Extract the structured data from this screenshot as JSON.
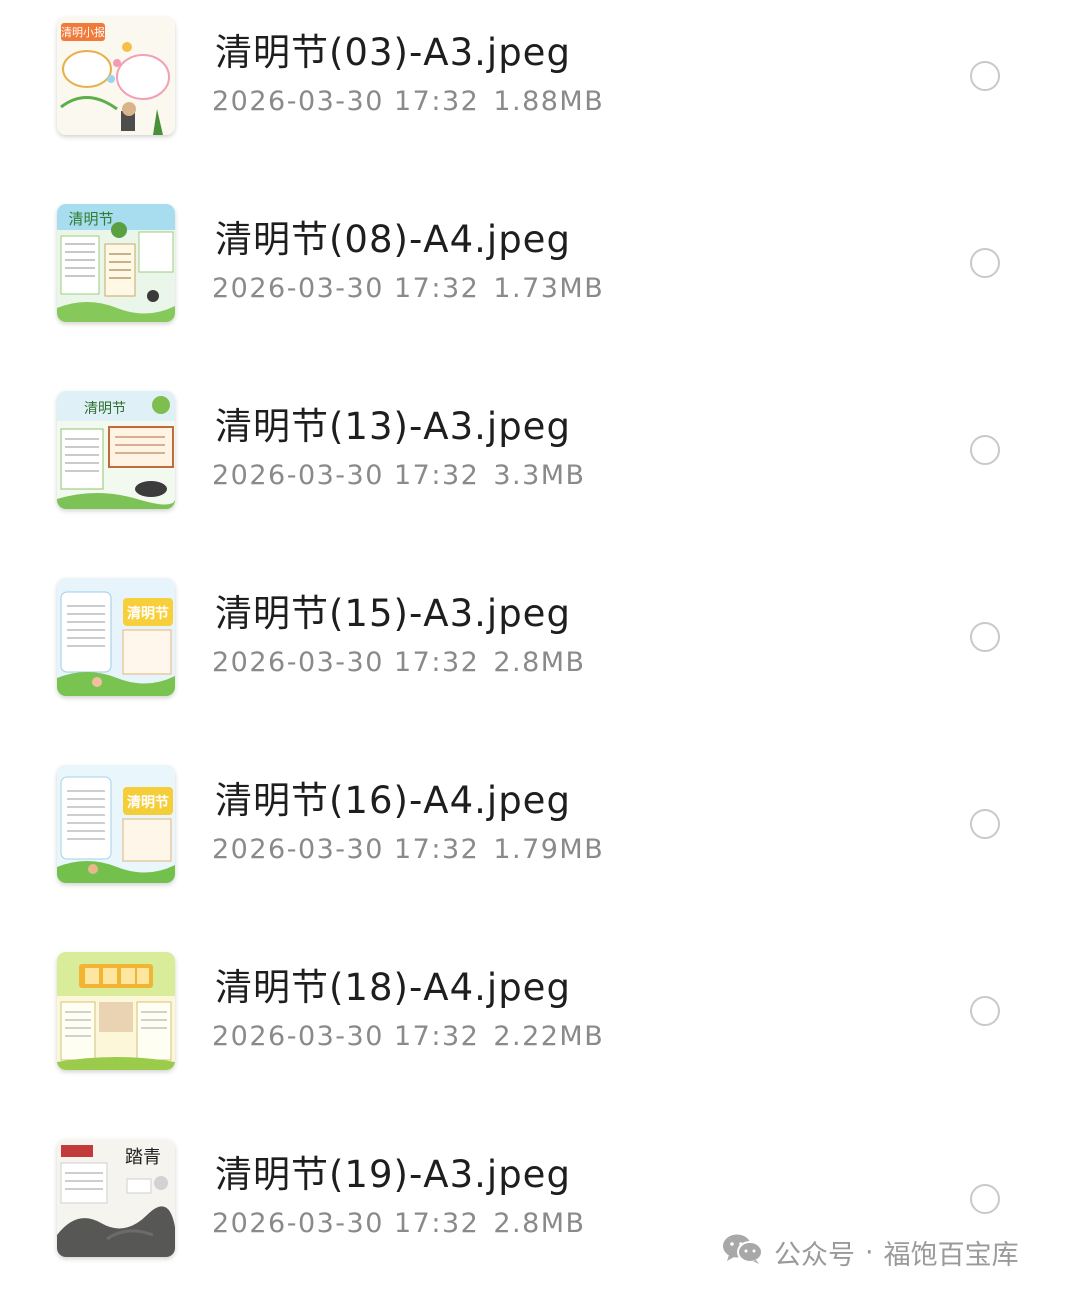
{
  "files": [
    {
      "name": "清明节(03)-A3.jpeg",
      "date": "2026-03-30 17:32",
      "size": "1.88MB",
      "thumb_title": "清明小报",
      "thumb_icon": "poster-thumbnail-icon",
      "selected": false
    },
    {
      "name": "清明节(08)-A4.jpeg",
      "date": "2026-03-30 17:32",
      "size": "1.73MB",
      "thumb_title": "清明节",
      "thumb_icon": "poster-thumbnail-icon",
      "selected": false
    },
    {
      "name": "清明节(13)-A3.jpeg",
      "date": "2026-03-30 17:32",
      "size": "3.3MB",
      "thumb_title": "清明节",
      "thumb_icon": "poster-thumbnail-icon",
      "selected": false
    },
    {
      "name": "清明节(15)-A3.jpeg",
      "date": "2026-03-30 17:32",
      "size": "2.8MB",
      "thumb_title": "清明节",
      "thumb_icon": "poster-thumbnail-icon",
      "selected": false
    },
    {
      "name": "清明节(16)-A4.jpeg",
      "date": "2026-03-30 17:32",
      "size": "1.79MB",
      "thumb_title": "清明节",
      "thumb_icon": "poster-thumbnail-icon",
      "selected": false
    },
    {
      "name": "清明节(18)-A4.jpeg",
      "date": "2026-03-30 17:32",
      "size": "2.22MB",
      "thumb_title": "",
      "thumb_icon": "poster-thumbnail-icon",
      "selected": false
    },
    {
      "name": "清明节(19)-A3.jpeg",
      "date": "2026-03-30 17:32",
      "size": "2.8MB",
      "thumb_title": "踏青",
      "thumb_icon": "poster-thumbnail-icon",
      "selected": false
    }
  ],
  "watermark": {
    "icon": "wechat-icon",
    "account_label": "公众号",
    "separator": "·",
    "account_name": "福饱百宝库"
  },
  "colors": {
    "filename": "#1e1e1e",
    "meta": "#8a8a8a",
    "radio_border": "#c9c9c9",
    "watermark": "#9a9a9a"
  }
}
